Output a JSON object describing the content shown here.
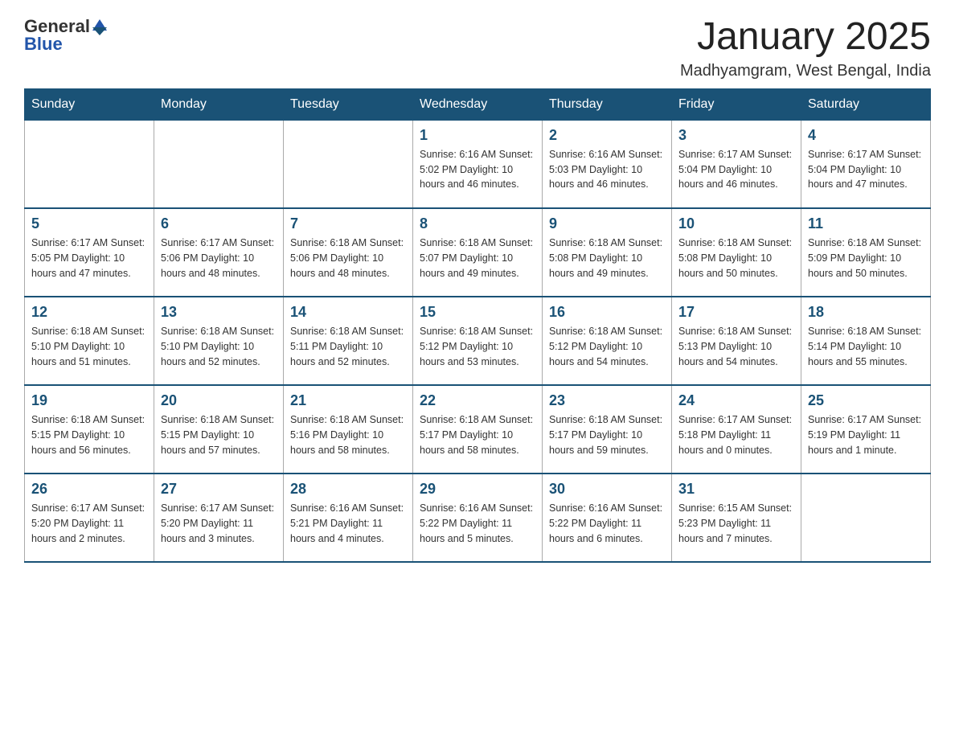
{
  "header": {
    "logo_general": "General",
    "logo_blue": "Blue",
    "title": "January 2025",
    "subtitle": "Madhyamgram, West Bengal, India"
  },
  "columns": [
    "Sunday",
    "Monday",
    "Tuesday",
    "Wednesday",
    "Thursday",
    "Friday",
    "Saturday"
  ],
  "weeks": [
    [
      {
        "day": "",
        "info": ""
      },
      {
        "day": "",
        "info": ""
      },
      {
        "day": "",
        "info": ""
      },
      {
        "day": "1",
        "info": "Sunrise: 6:16 AM\nSunset: 5:02 PM\nDaylight: 10 hours and 46 minutes."
      },
      {
        "day": "2",
        "info": "Sunrise: 6:16 AM\nSunset: 5:03 PM\nDaylight: 10 hours and 46 minutes."
      },
      {
        "day": "3",
        "info": "Sunrise: 6:17 AM\nSunset: 5:04 PM\nDaylight: 10 hours and 46 minutes."
      },
      {
        "day": "4",
        "info": "Sunrise: 6:17 AM\nSunset: 5:04 PM\nDaylight: 10 hours and 47 minutes."
      }
    ],
    [
      {
        "day": "5",
        "info": "Sunrise: 6:17 AM\nSunset: 5:05 PM\nDaylight: 10 hours and 47 minutes."
      },
      {
        "day": "6",
        "info": "Sunrise: 6:17 AM\nSunset: 5:06 PM\nDaylight: 10 hours and 48 minutes."
      },
      {
        "day": "7",
        "info": "Sunrise: 6:18 AM\nSunset: 5:06 PM\nDaylight: 10 hours and 48 minutes."
      },
      {
        "day": "8",
        "info": "Sunrise: 6:18 AM\nSunset: 5:07 PM\nDaylight: 10 hours and 49 minutes."
      },
      {
        "day": "9",
        "info": "Sunrise: 6:18 AM\nSunset: 5:08 PM\nDaylight: 10 hours and 49 minutes."
      },
      {
        "day": "10",
        "info": "Sunrise: 6:18 AM\nSunset: 5:08 PM\nDaylight: 10 hours and 50 minutes."
      },
      {
        "day": "11",
        "info": "Sunrise: 6:18 AM\nSunset: 5:09 PM\nDaylight: 10 hours and 50 minutes."
      }
    ],
    [
      {
        "day": "12",
        "info": "Sunrise: 6:18 AM\nSunset: 5:10 PM\nDaylight: 10 hours and 51 minutes."
      },
      {
        "day": "13",
        "info": "Sunrise: 6:18 AM\nSunset: 5:10 PM\nDaylight: 10 hours and 52 minutes."
      },
      {
        "day": "14",
        "info": "Sunrise: 6:18 AM\nSunset: 5:11 PM\nDaylight: 10 hours and 52 minutes."
      },
      {
        "day": "15",
        "info": "Sunrise: 6:18 AM\nSunset: 5:12 PM\nDaylight: 10 hours and 53 minutes."
      },
      {
        "day": "16",
        "info": "Sunrise: 6:18 AM\nSunset: 5:12 PM\nDaylight: 10 hours and 54 minutes."
      },
      {
        "day": "17",
        "info": "Sunrise: 6:18 AM\nSunset: 5:13 PM\nDaylight: 10 hours and 54 minutes."
      },
      {
        "day": "18",
        "info": "Sunrise: 6:18 AM\nSunset: 5:14 PM\nDaylight: 10 hours and 55 minutes."
      }
    ],
    [
      {
        "day": "19",
        "info": "Sunrise: 6:18 AM\nSunset: 5:15 PM\nDaylight: 10 hours and 56 minutes."
      },
      {
        "day": "20",
        "info": "Sunrise: 6:18 AM\nSunset: 5:15 PM\nDaylight: 10 hours and 57 minutes."
      },
      {
        "day": "21",
        "info": "Sunrise: 6:18 AM\nSunset: 5:16 PM\nDaylight: 10 hours and 58 minutes."
      },
      {
        "day": "22",
        "info": "Sunrise: 6:18 AM\nSunset: 5:17 PM\nDaylight: 10 hours and 58 minutes."
      },
      {
        "day": "23",
        "info": "Sunrise: 6:18 AM\nSunset: 5:17 PM\nDaylight: 10 hours and 59 minutes."
      },
      {
        "day": "24",
        "info": "Sunrise: 6:17 AM\nSunset: 5:18 PM\nDaylight: 11 hours and 0 minutes."
      },
      {
        "day": "25",
        "info": "Sunrise: 6:17 AM\nSunset: 5:19 PM\nDaylight: 11 hours and 1 minute."
      }
    ],
    [
      {
        "day": "26",
        "info": "Sunrise: 6:17 AM\nSunset: 5:20 PM\nDaylight: 11 hours and 2 minutes."
      },
      {
        "day": "27",
        "info": "Sunrise: 6:17 AM\nSunset: 5:20 PM\nDaylight: 11 hours and 3 minutes."
      },
      {
        "day": "28",
        "info": "Sunrise: 6:16 AM\nSunset: 5:21 PM\nDaylight: 11 hours and 4 minutes."
      },
      {
        "day": "29",
        "info": "Sunrise: 6:16 AM\nSunset: 5:22 PM\nDaylight: 11 hours and 5 minutes."
      },
      {
        "day": "30",
        "info": "Sunrise: 6:16 AM\nSunset: 5:22 PM\nDaylight: 11 hours and 6 minutes."
      },
      {
        "day": "31",
        "info": "Sunrise: 6:15 AM\nSunset: 5:23 PM\nDaylight: 11 hours and 7 minutes."
      },
      {
        "day": "",
        "info": ""
      }
    ]
  ]
}
